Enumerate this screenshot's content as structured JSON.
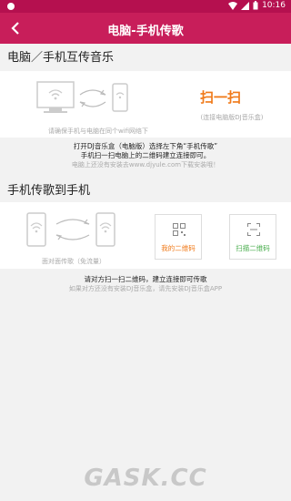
{
  "status_bar": {
    "time": "10:16"
  },
  "header": {
    "title": "电脑-手机传歌"
  },
  "section1": {
    "title": "电脑／手机互传音乐",
    "wifi_hint": "请确保手机与电脑在同个wifi网络下",
    "scan_label": "扫一扫",
    "scan_sub": "(连接电脑版DJ音乐盒)",
    "instr_line1": "打开DJ音乐盒（电脑版）选择左下角“手机传歌”",
    "instr_line2": "手机扫一扫电脑上的二维码建立连接即可。",
    "instr_line3": "电脑上还没有安装去www.djyule.com下载安装哦！"
  },
  "section2": {
    "title": "手机传歌到手机",
    "face_hint": "面对面传歌（免流量）",
    "my_qr_label": "我的二维码",
    "scan_qr_label": "扫描二维码",
    "instr_line1": "请对方扫一扫二维码，建立连接即可传歌",
    "instr_line2": "如果对方还没有安装DJ音乐盒，请先安装DJ音乐盒APP"
  },
  "watermark": {
    "text": "GASK.CC"
  },
  "colors": {
    "brand": "#c81e5a",
    "status": "#b5104f",
    "orange": "#f07a1a",
    "green": "#4caf50"
  }
}
